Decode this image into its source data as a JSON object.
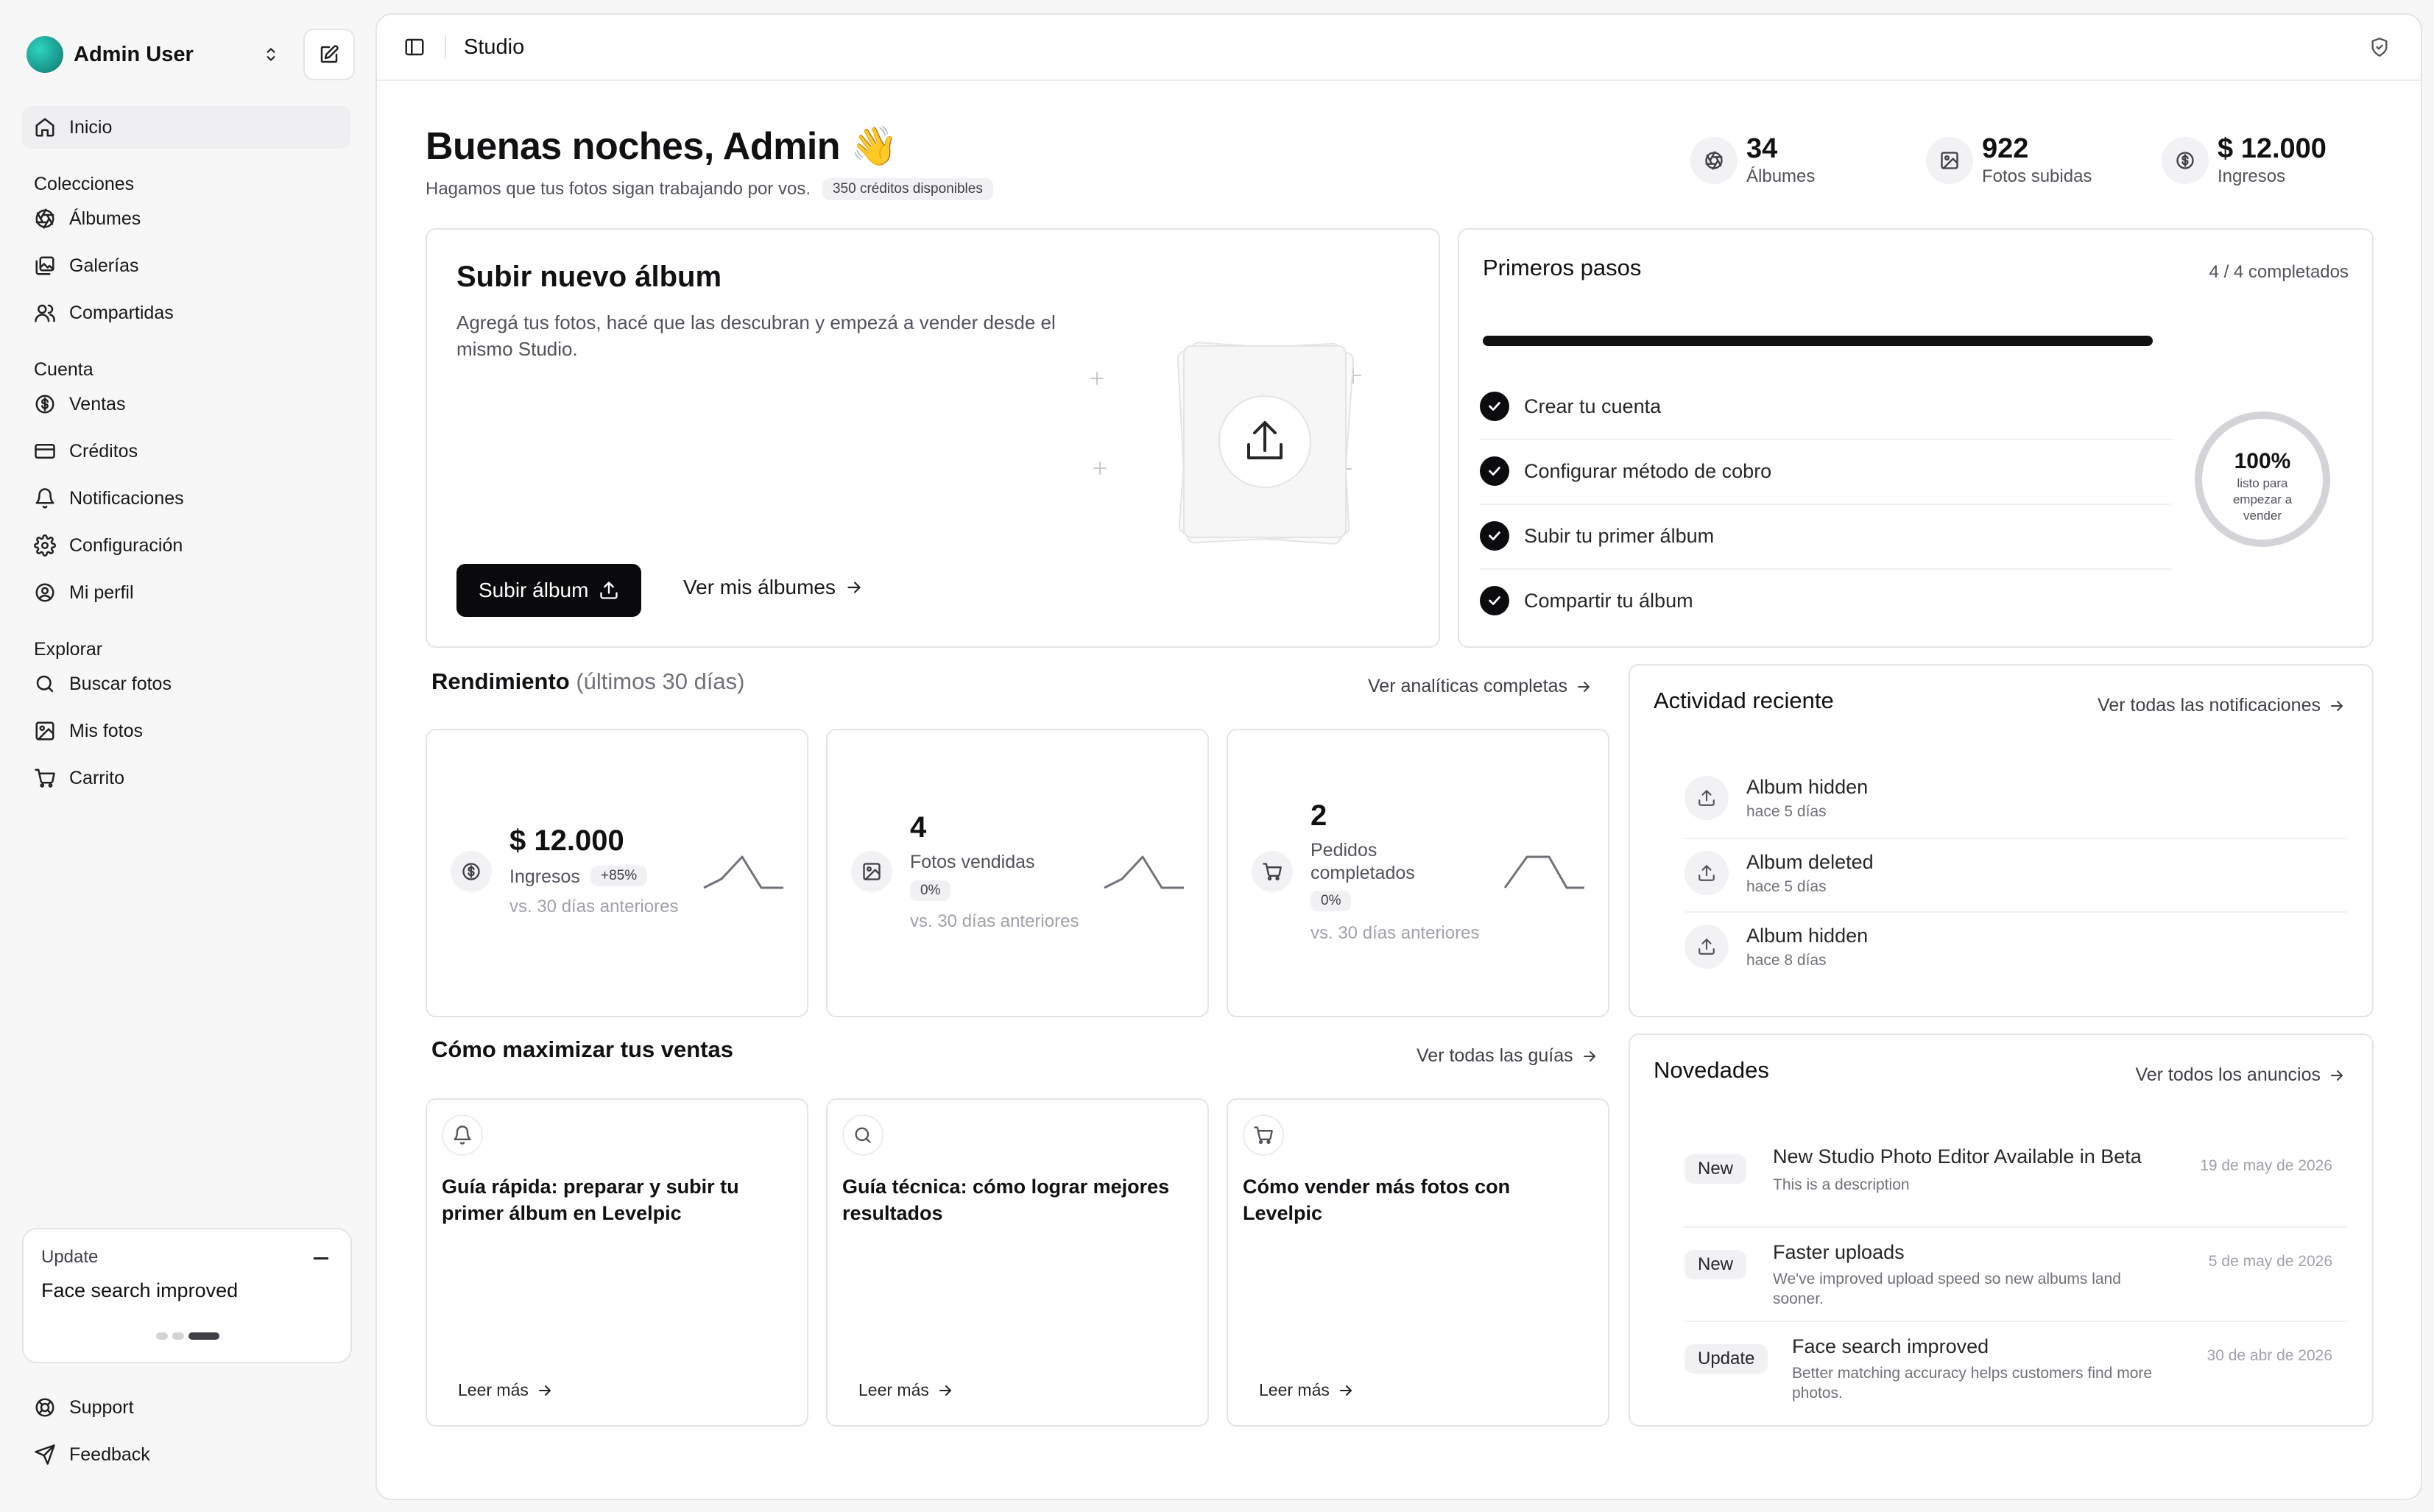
{
  "user": {
    "name": "Admin User"
  },
  "sidebar": {
    "home": "Inicio",
    "groups": [
      {
        "label": "Colecciones",
        "items": [
          "Álbumes",
          "Galerías",
          "Compartidas"
        ]
      },
      {
        "label": "Cuenta",
        "items": [
          "Ventas",
          "Créditos",
          "Notificaciones",
          "Configuración",
          "Mi perfil"
        ]
      },
      {
        "label": "Explorar",
        "items": [
          "Buscar fotos",
          "Mis fotos",
          "Carrito"
        ]
      }
    ],
    "update_card": {
      "tag": "Update",
      "title": "Face search improved"
    },
    "footer": [
      "Support",
      "Feedback"
    ]
  },
  "topbar": {
    "title": "Studio"
  },
  "greeting": {
    "title": "Buenas noches, Admin 👋",
    "subtitle": "Hagamos que tus fotos sigan trabajando por vos.",
    "credits": "350 créditos disponibles"
  },
  "stats": [
    {
      "value": "34",
      "label": "Álbumes",
      "icon": "aperture-icon"
    },
    {
      "value": "922",
      "label": "Fotos subidas",
      "icon": "image-icon"
    },
    {
      "value": "$ 12.000",
      "label": "Ingresos",
      "icon": "dollar-icon"
    }
  ],
  "upload": {
    "title": "Subir nuevo álbum",
    "description": "Agregá tus fotos, hacé que las descubran y empezá a vender desde el mismo Studio.",
    "primary": "Subir álbum",
    "secondary": "Ver mis álbumes"
  },
  "steps": {
    "title": "Primeros pasos",
    "count": "4 / 4 completados",
    "progress": 1.0,
    "items": [
      "Crear tu cuenta",
      "Configurar método de cobro",
      "Subir tu primer álbum",
      "Compartir tu álbum"
    ],
    "percent": "100%",
    "percent_label": "listo para empezar a vender"
  },
  "performance": {
    "title": "Rendimiento",
    "period": "(últimos 30 días)",
    "link": "Ver analíticas completas",
    "cards": [
      {
        "value": "$ 12.000",
        "label": "Ingresos",
        "change": "+85%",
        "vs": "vs. 30 días anteriores",
        "icon": "dollar-icon"
      },
      {
        "value": "4",
        "label": "Fotos vendidas",
        "change": "0%",
        "vs": "vs. 30 días anteriores",
        "icon": "image-icon"
      },
      {
        "value": "2",
        "label": "Pedidos completados",
        "change": "0%",
        "vs": "vs. 30 días anteriores",
        "icon": "cart-icon"
      }
    ]
  },
  "activity": {
    "title": "Actividad reciente",
    "link": "Ver todas las notificaciones",
    "items": [
      {
        "title": "Album hidden",
        "time": "hace 5 días"
      },
      {
        "title": "Album deleted",
        "time": "hace 5 días"
      },
      {
        "title": "Album hidden",
        "time": "hace 8 días"
      }
    ]
  },
  "guides": {
    "title": "Cómo maximizar tus ventas",
    "link": "Ver todas las guías",
    "read_more": "Leer más",
    "items": [
      {
        "title": "Guía rápida: preparar y subir tu primer álbum en Levelpic",
        "icon": "bell-icon"
      },
      {
        "title": "Guía técnica: cómo lograr mejores resultados",
        "icon": "search-icon"
      },
      {
        "title": "Cómo vender más fotos con Levelpic",
        "icon": "cart-icon"
      }
    ]
  },
  "news": {
    "title": "Novedades",
    "link": "Ver todos los anuncios",
    "items": [
      {
        "badge": "New",
        "title": "New Studio Photo Editor Available in Beta",
        "desc": "This is a description",
        "date": "19 de may de 2026"
      },
      {
        "badge": "New",
        "title": "Faster uploads",
        "desc": "We've improved upload speed so new albums land sooner.",
        "date": "5 de may de 2026"
      },
      {
        "badge": "Update",
        "title": "Face search improved",
        "desc": "Better matching accuracy helps customers find more photos.",
        "date": "30 de abr de 2026"
      }
    ]
  }
}
